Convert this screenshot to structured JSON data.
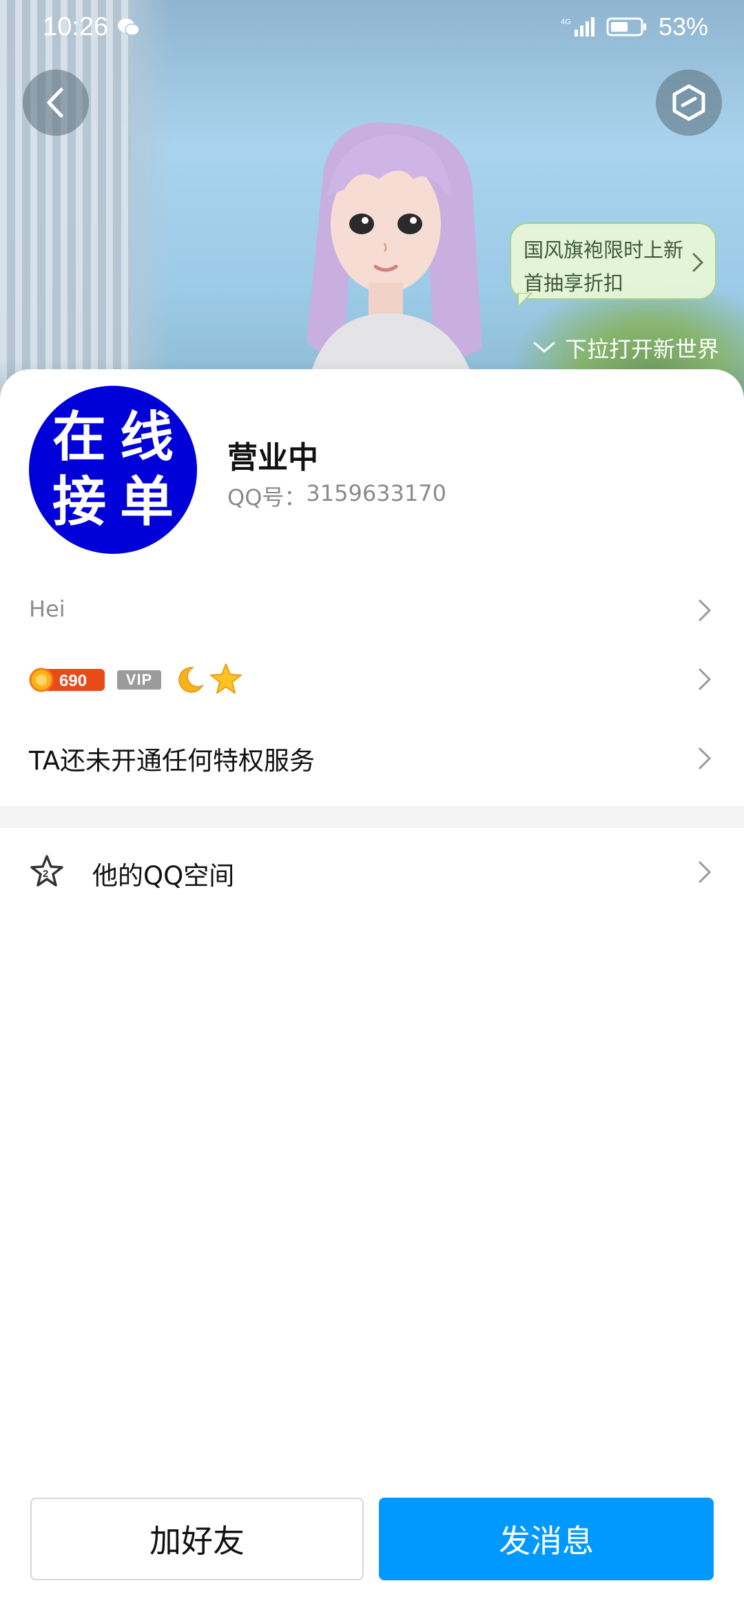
{
  "status_bar": {
    "time": "10:26",
    "battery_percent": "53%",
    "network": "4G"
  },
  "banner": {
    "promo_line1": "国风旗袍限时上新",
    "promo_line2": "首抽享折扣",
    "pull_hint": "下拉打开新世界"
  },
  "profile": {
    "avatar_chars": [
      "在",
      "线",
      "接",
      "单"
    ],
    "nickname": "营业中",
    "qq_label": "QQ号：",
    "qq_number": "3159633170",
    "signature": "Hei",
    "level_number": "690",
    "vip_label": "VIP",
    "privilege_text": "TA还未开通任何特权服务",
    "qzone_label": "他的QQ空间",
    "qzone_icon_digit": "2"
  },
  "actions": {
    "add_friend": "加好友",
    "send_message": "发消息"
  },
  "colors": {
    "accent": "#0099ff",
    "avatar_bg": "#0000d9"
  }
}
